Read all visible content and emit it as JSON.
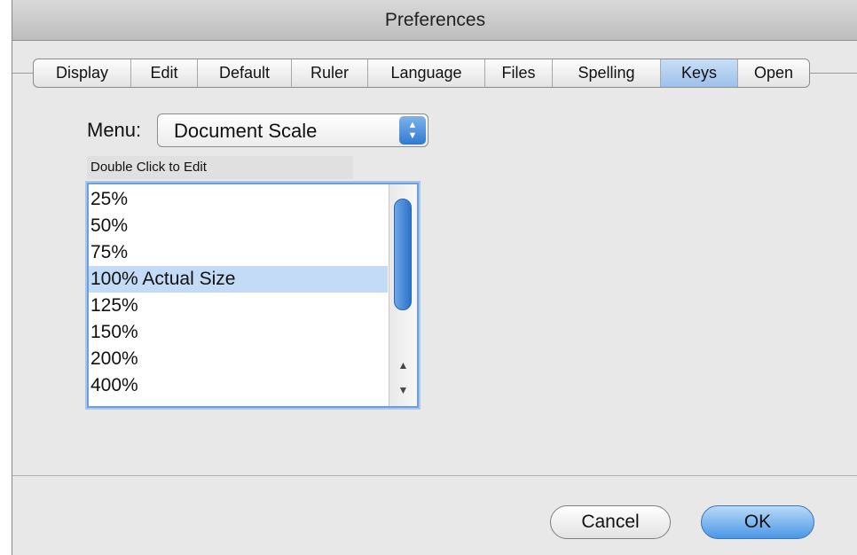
{
  "window": {
    "title": "Preferences"
  },
  "tabs": [
    {
      "label": "Display"
    },
    {
      "label": "Edit"
    },
    {
      "label": "Default"
    },
    {
      "label": "Ruler"
    },
    {
      "label": "Language"
    },
    {
      "label": "Files"
    },
    {
      "label": "Spelling"
    },
    {
      "label": "Keys",
      "active": true
    },
    {
      "label": "Open"
    }
  ],
  "menu": {
    "label": "Menu:",
    "selected": "Document Scale",
    "arrows_icon": "up-down-arrows-icon"
  },
  "list": {
    "hint": "Double Click to Edit",
    "items": [
      "25%",
      "50%",
      "75%",
      "100% Actual Size",
      "125%",
      "150%",
      "200%",
      "400%"
    ],
    "selected_index": 3
  },
  "buttons": {
    "cancel": "Cancel",
    "ok": "OK"
  },
  "colors": {
    "accent": "#4a97e6",
    "selection": "#c3dbf7",
    "active_tab": "#9dc0ea"
  }
}
